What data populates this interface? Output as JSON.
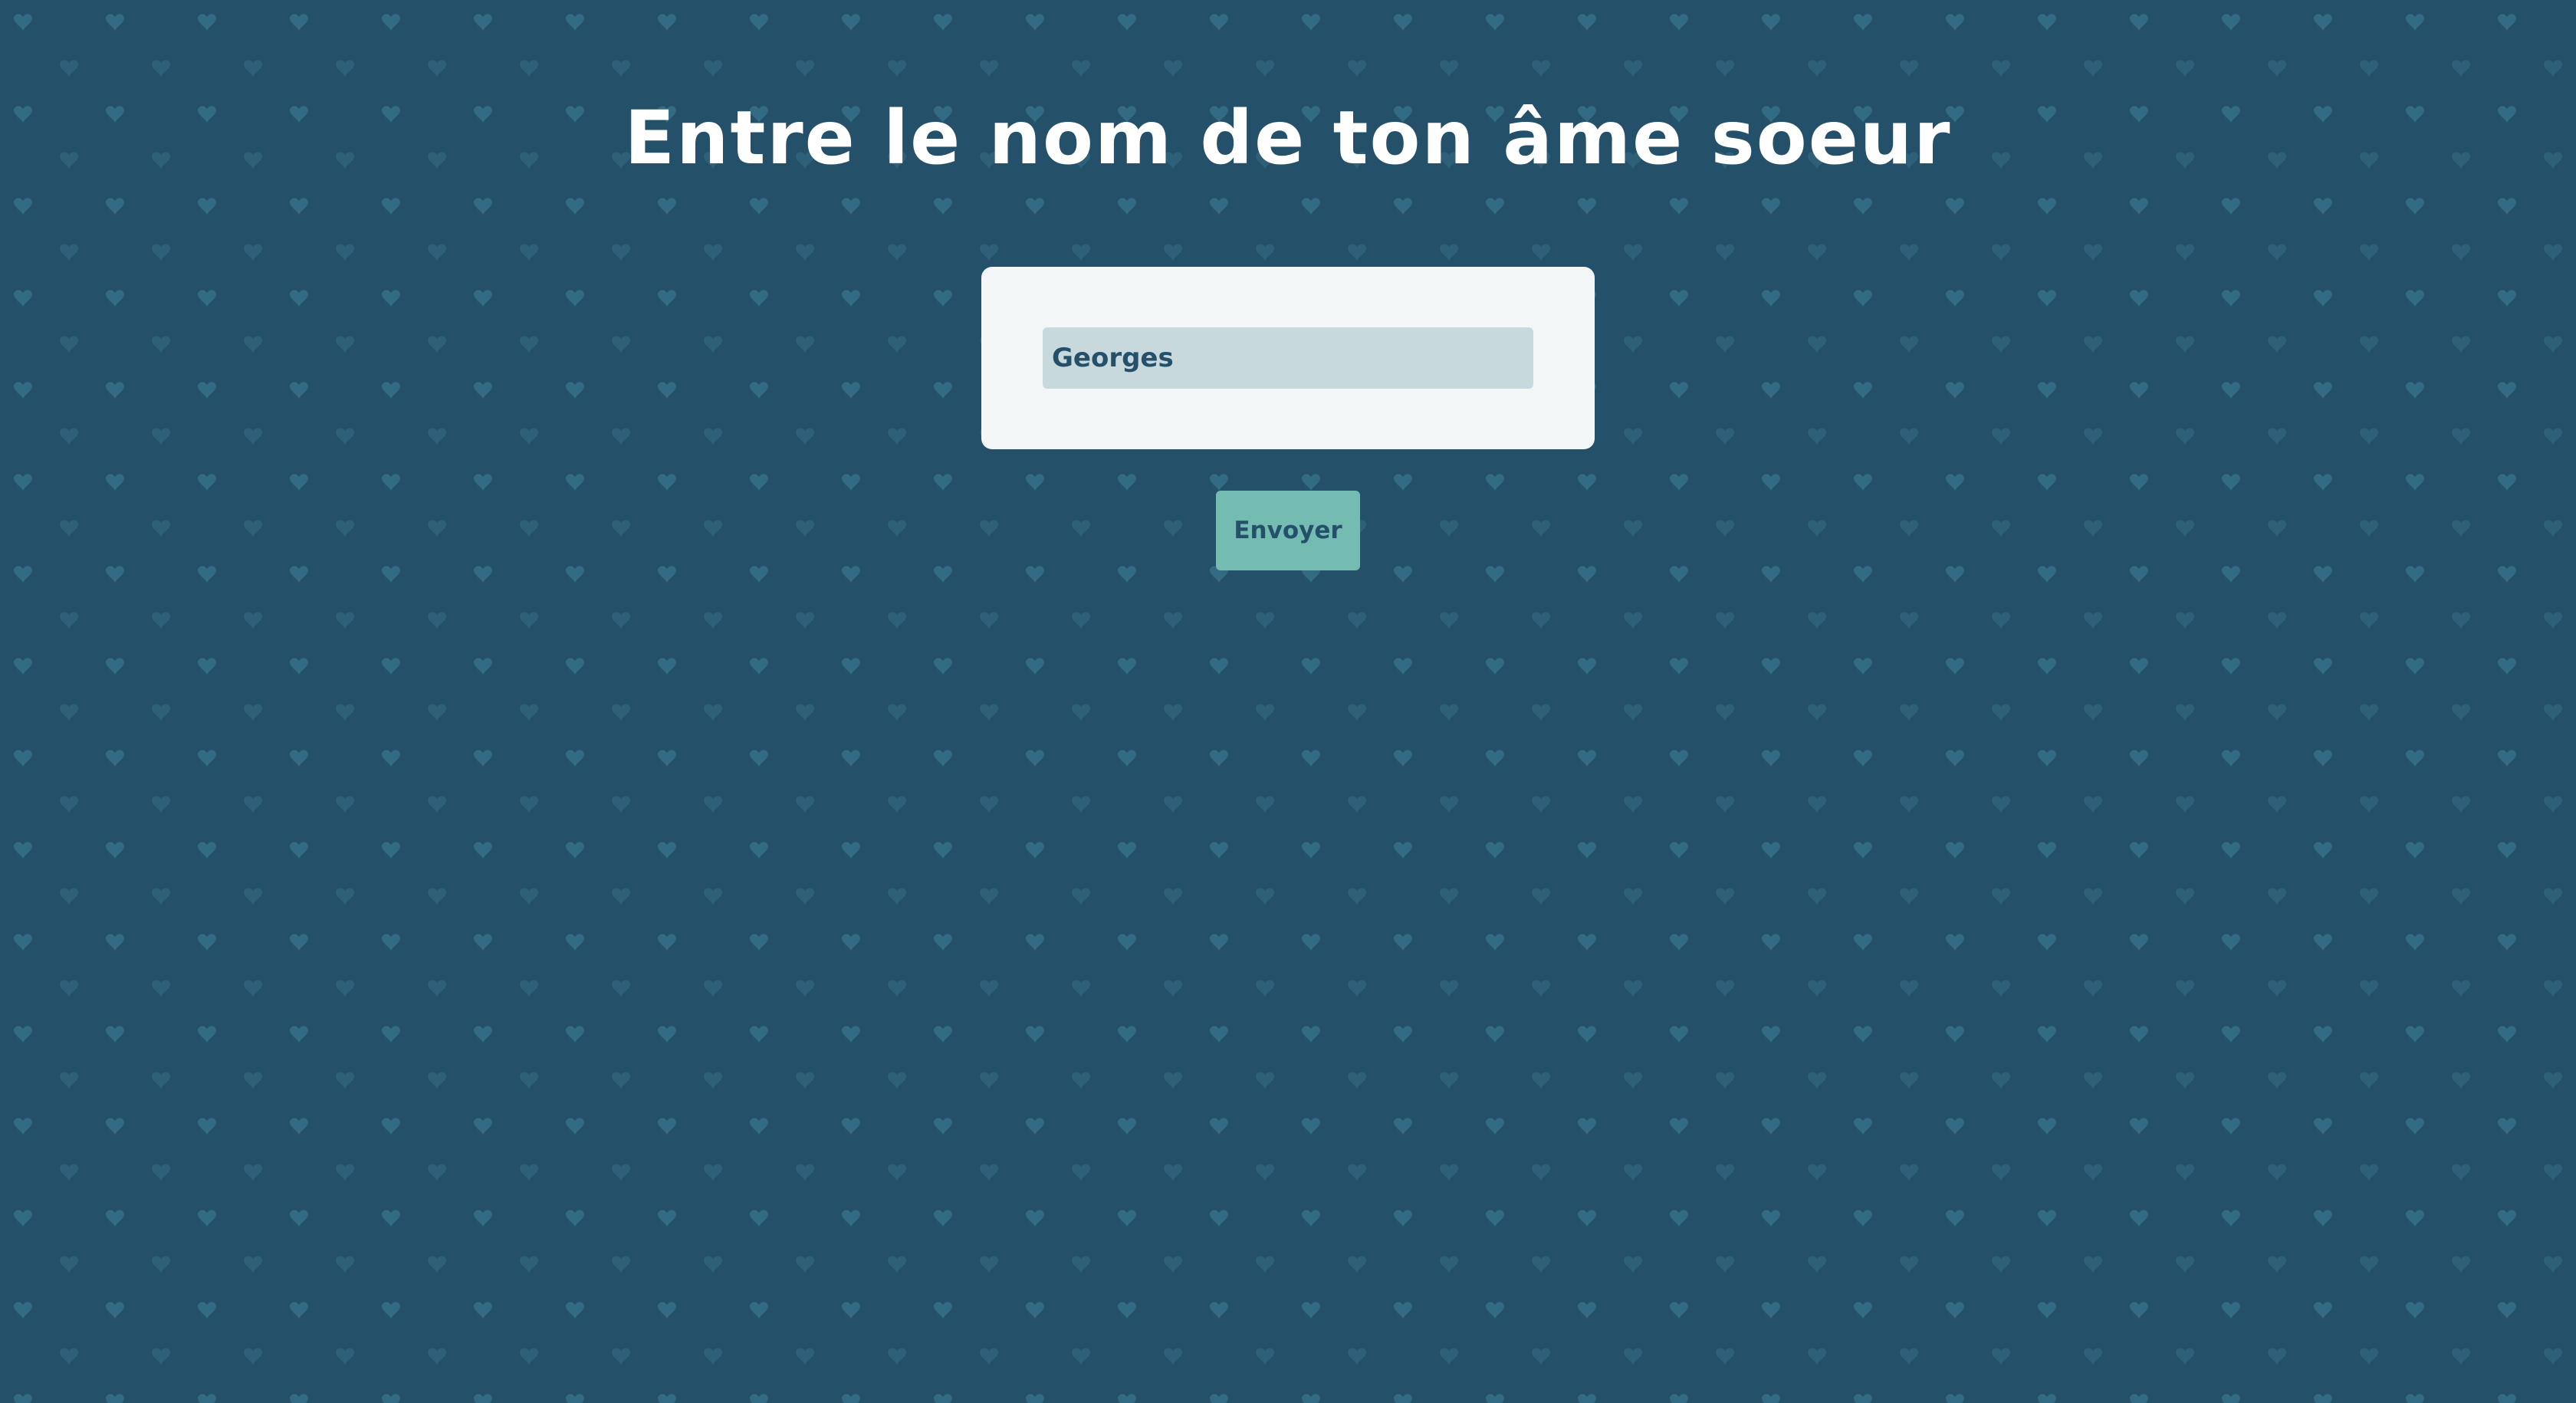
{
  "page": {
    "title": "Entre le nom de ton âme soeur",
    "background_color": "#245069",
    "pattern_icon": "heart-icon"
  },
  "form": {
    "name_value": "Georges",
    "input_background": "#c8d9de",
    "card_background": "#f3f6f7",
    "submit_label": "Envoyer",
    "submit_background": "#74bbb2"
  }
}
